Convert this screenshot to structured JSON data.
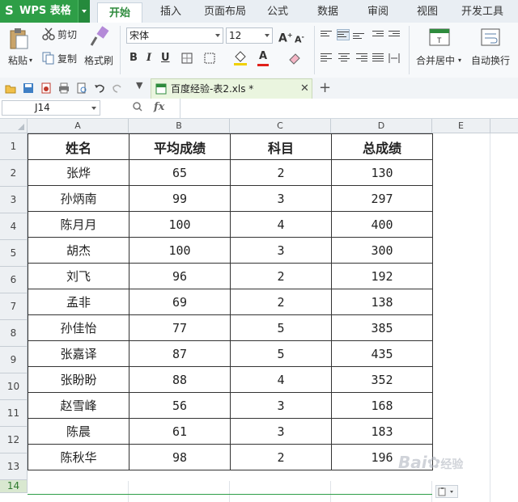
{
  "app": {
    "name": "WPS 表格",
    "accent": "#2e9e47"
  },
  "tabs": [
    {
      "label": "开始",
      "active": true
    },
    {
      "label": "插入",
      "active": false
    },
    {
      "label": "页面布局",
      "active": false
    },
    {
      "label": "公式",
      "active": false
    },
    {
      "label": "数据",
      "active": false
    },
    {
      "label": "审阅",
      "active": false
    },
    {
      "label": "视图",
      "active": false
    },
    {
      "label": "开发工具",
      "active": false
    }
  ],
  "ribbon": {
    "paste_label": "粘贴",
    "cut_label": "剪切",
    "copy_label": "复制",
    "format_painter_label": "格式刷",
    "font_name": "宋体",
    "font_size": "12",
    "merge_center_label": "合并居中",
    "wrap_label": "自动换行"
  },
  "document": {
    "tab_name": "百度经验-表2.xls *"
  },
  "formula_bar": {
    "cell_ref": "J14",
    "fx": "fx"
  },
  "columns": [
    "A",
    "B",
    "C",
    "D",
    "E"
  ],
  "row_numbers": [
    "1",
    "2",
    "3",
    "4",
    "5",
    "6",
    "7",
    "8",
    "9",
    "10",
    "11",
    "12",
    "13",
    "14"
  ],
  "table": {
    "headers": [
      "姓名",
      "平均成绩",
      "科目",
      "总成绩"
    ],
    "rows": [
      [
        "张烨",
        "65",
        "2",
        "130"
      ],
      [
        "孙炳南",
        "99",
        "3",
        "297"
      ],
      [
        "陈月月",
        "100",
        "4",
        "400"
      ],
      [
        "胡杰",
        "100",
        "3",
        "300"
      ],
      [
        "刘飞",
        "96",
        "2",
        "192"
      ],
      [
        "孟非",
        "69",
        "2",
        "138"
      ],
      [
        "孙佳怡",
        "77",
        "5",
        "385"
      ],
      [
        "张嘉译",
        "87",
        "5",
        "435"
      ],
      [
        "张盼盼",
        "88",
        "4",
        "352"
      ],
      [
        "赵雪峰",
        "56",
        "3",
        "168"
      ],
      [
        "陈晨",
        "61",
        "3",
        "183"
      ],
      [
        "陈秋华",
        "98",
        "2",
        "196"
      ]
    ]
  },
  "watermark": {
    "text": "Bai",
    "suffix": "经验"
  }
}
